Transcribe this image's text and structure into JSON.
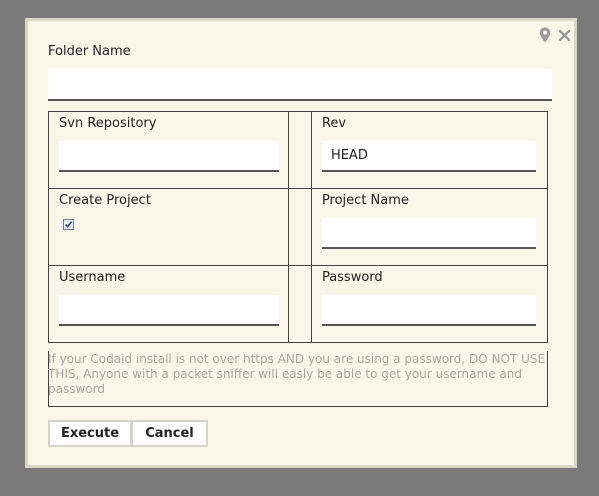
{
  "dialog": {
    "folder_name_label": "Folder Name",
    "folder_name_value": "",
    "fields": {
      "svn_repository_label": "Svn Repository",
      "svn_repository_value": "",
      "rev_label": "Rev",
      "rev_value": "HEAD",
      "create_project_label": "Create Project",
      "create_project_checked": true,
      "project_name_label": "Project Name",
      "project_name_value": "",
      "username_label": "Username",
      "username_value": "",
      "password_label": "Password",
      "password_value": ""
    },
    "warning": "If your Codaid install is not over https AND you are using a password, DO NOT USE THIS, Anyone with a packet sniffer will easly be able to get your username and password",
    "buttons": {
      "execute": "Execute",
      "cancel": "Cancel"
    },
    "icons": {
      "pin": "map-pin-icon",
      "close": "close-icon"
    }
  },
  "colors": {
    "overlay": "#7a7a7a",
    "dialog_bg": "#f8f7e9",
    "dialog_border": "#d8d6c4",
    "warning_text": "#a8a8a0"
  }
}
